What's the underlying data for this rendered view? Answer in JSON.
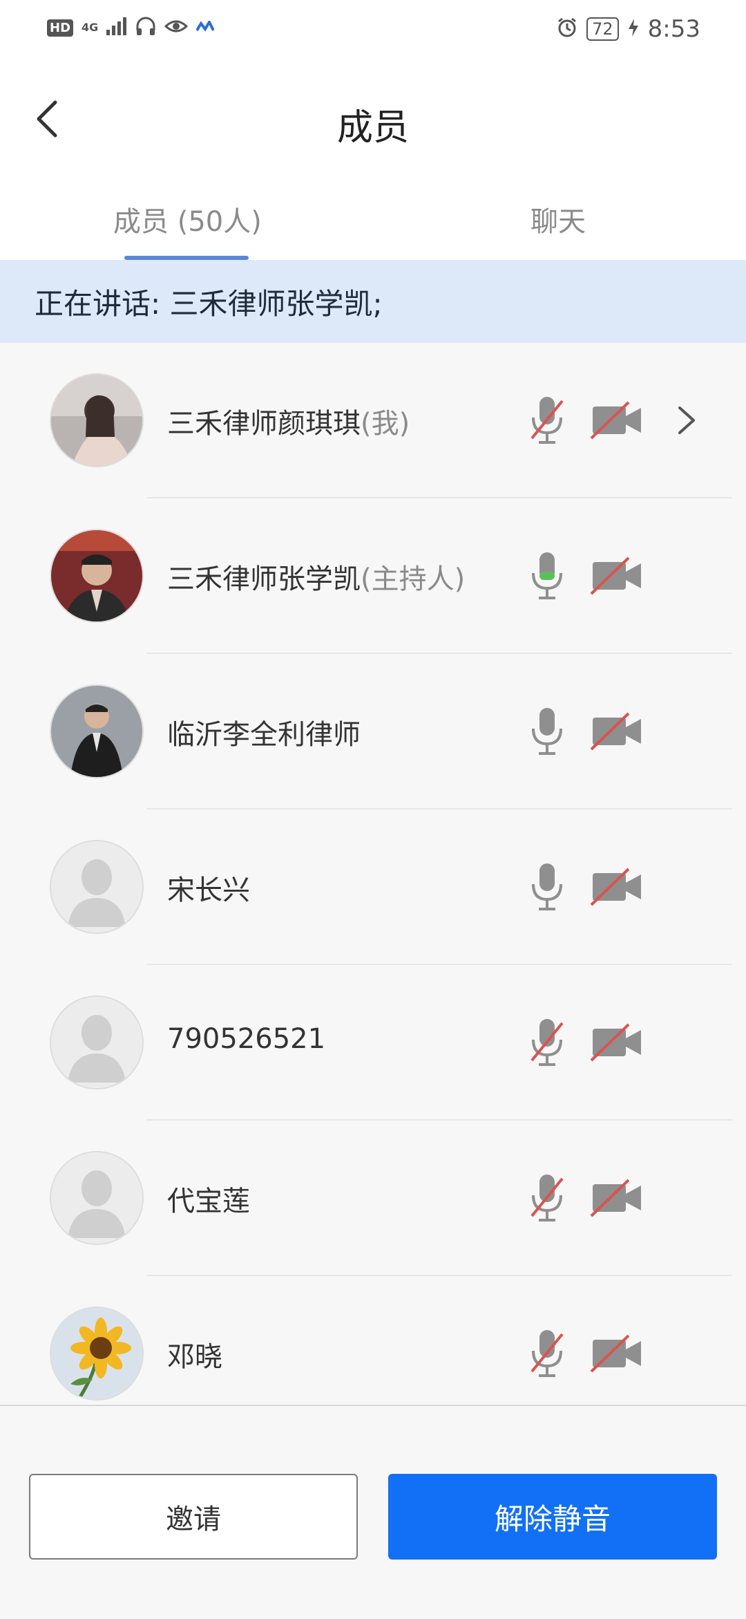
{
  "status_bar": {
    "left_badge": "HD",
    "network": "4G",
    "battery": "72",
    "time": "8:53"
  },
  "header": {
    "title": "成员"
  },
  "tabs": {
    "members": "成员 (50人)",
    "chat": "聊天"
  },
  "speaking_banner": "正在讲话: 三禾律师张学凯;",
  "members": [
    {
      "name": "三禾律师颜琪琪",
      "tag": "(我)",
      "avatar": "photo-portrait",
      "mic": "muted",
      "camera": "off"
    },
    {
      "name": "三禾律师张学凯",
      "tag": "(主持人)",
      "avatar": "photo-portrait",
      "mic": "active",
      "camera": "off"
    },
    {
      "name": "临沂李全利律师",
      "tag": "",
      "avatar": "photo-portrait",
      "mic": "unmuted",
      "camera": "off"
    },
    {
      "name": "宋长兴",
      "tag": "",
      "avatar": "default-silhouette",
      "mic": "unmuted",
      "camera": "off"
    },
    {
      "name": "790526521",
      "tag": "",
      "avatar": "default-silhouette",
      "mic": "muted",
      "camera": "off"
    },
    {
      "name": "代宝莲",
      "tag": "",
      "avatar": "default-silhouette",
      "mic": "muted",
      "camera": "off"
    },
    {
      "name": "邓晓",
      "tag": "",
      "avatar": "sunflower-photo",
      "mic": "muted",
      "camera": "off"
    }
  ],
  "bottom_bar": {
    "invite_label": "邀请",
    "unmute_label": "解除静音"
  },
  "colors": {
    "accent": "#1170f5",
    "tab_indicator": "#5b85d8",
    "speaking_bg": "#dde9f8",
    "muted_slash": "#d9534f",
    "mic_active": "#5cbf5c",
    "icon_gray": "#8f8f8f"
  }
}
